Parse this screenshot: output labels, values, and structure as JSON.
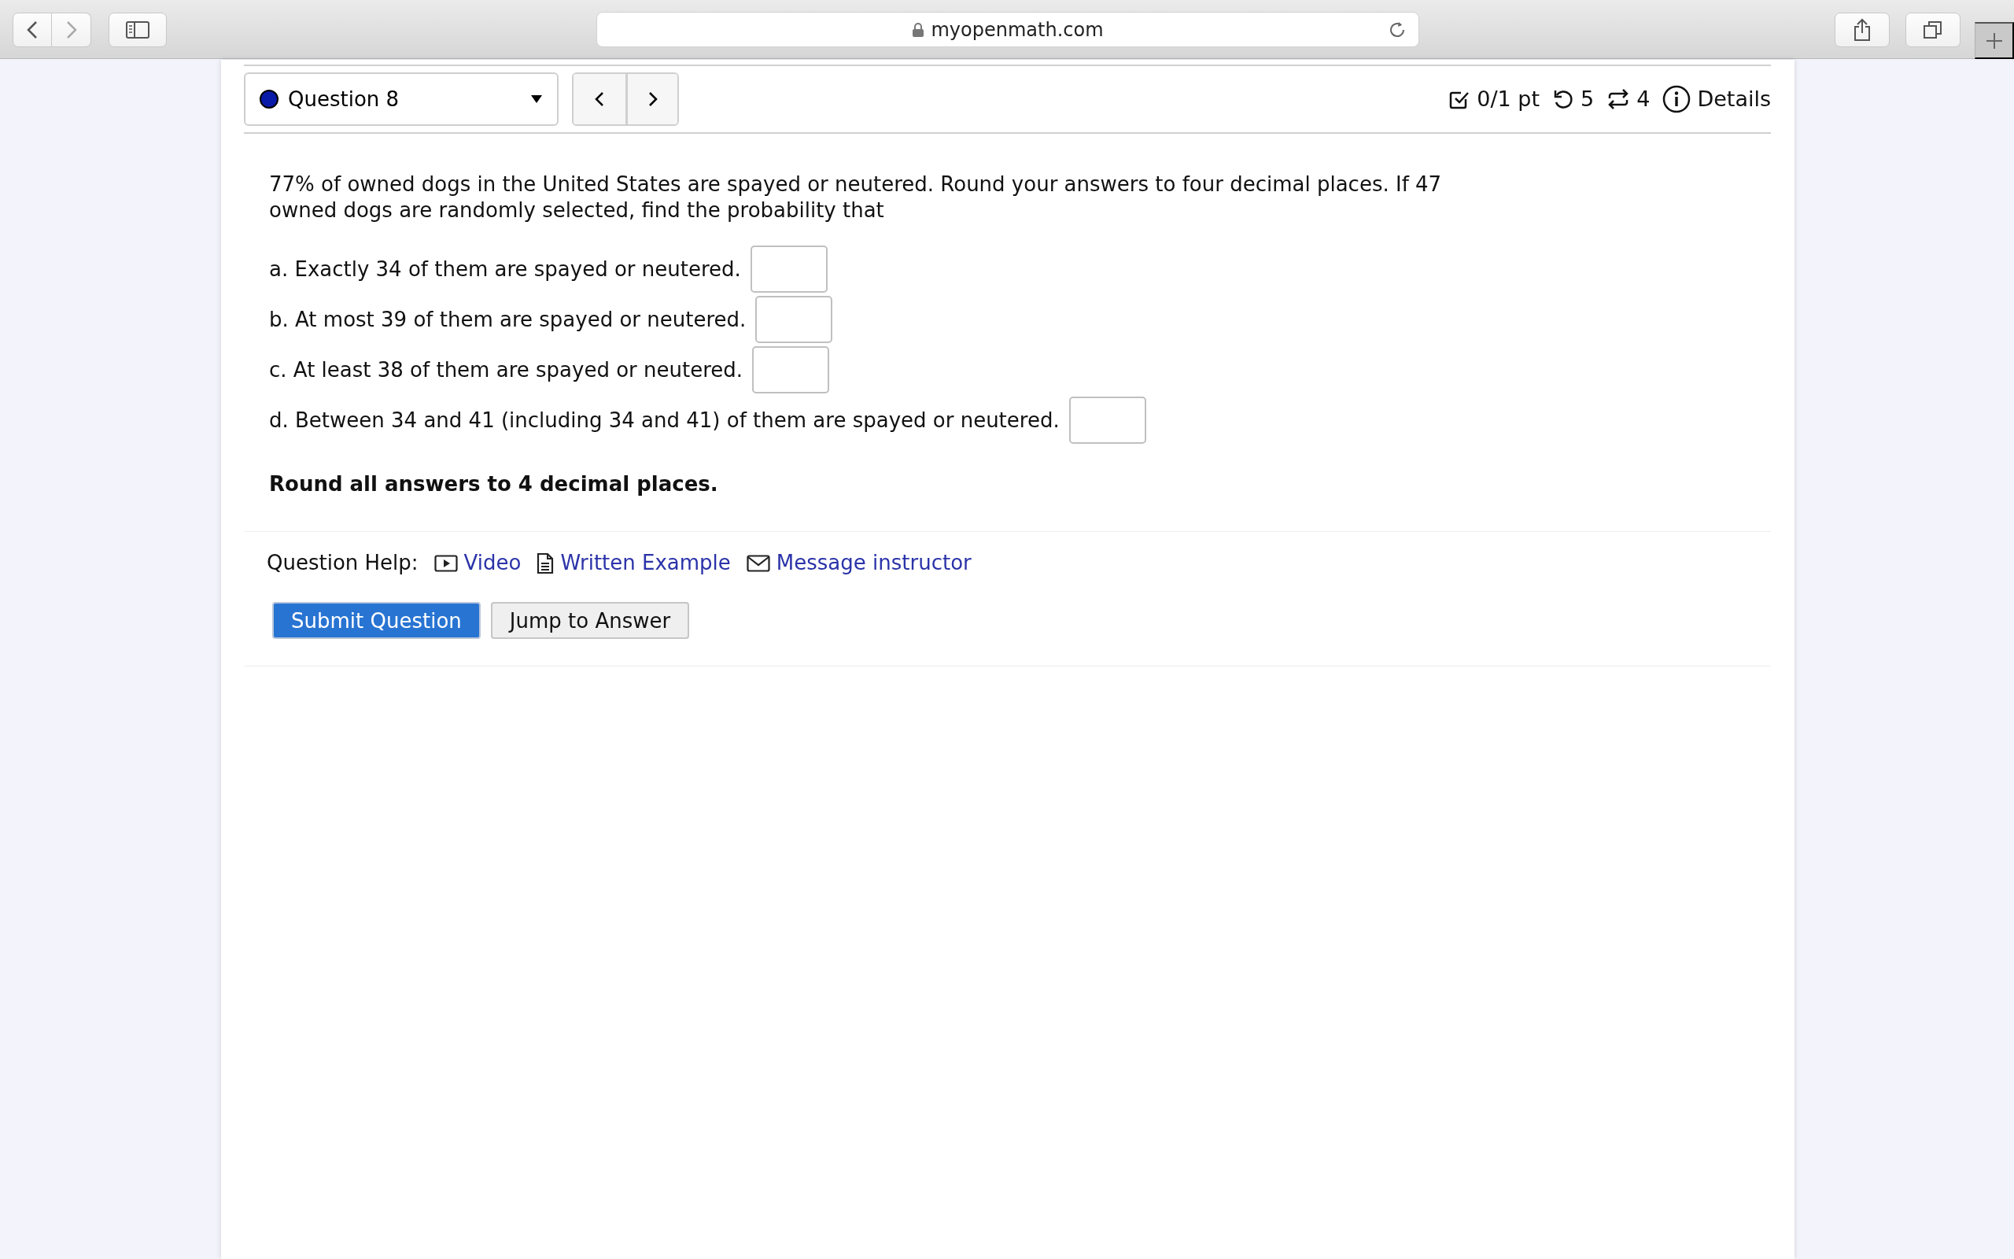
{
  "browser": {
    "url": "myopenmath.com"
  },
  "question_nav": {
    "label": "Question 8"
  },
  "score": {
    "points": "0/1 pt",
    "retries": "5",
    "versions": "4",
    "details": "Details"
  },
  "question": {
    "text": "77% of owned dogs in the United States are spayed or neutered. Round your answers to four decimal places. If 47 owned dogs are randomly selected, find the probability that",
    "parts": [
      {
        "label": "a. Exactly 34 of them are spayed or neutered."
      },
      {
        "label": "b. At most 39 of them are spayed or neutered."
      },
      {
        "label": "c. At least 38 of them are spayed or neutered."
      },
      {
        "label": "d. Between 34 and 41 (including 34 and 41) of them are spayed or neutered."
      }
    ],
    "note": "Round all answers to 4 decimal places."
  },
  "help": {
    "label": "Question Help:",
    "links": [
      {
        "kind": "video",
        "label": "Video"
      },
      {
        "kind": "document",
        "label": "Written Example"
      },
      {
        "kind": "mail",
        "label": "Message instructor"
      }
    ]
  },
  "buttons": [
    {
      "kind": "primary",
      "label": "Submit Question"
    },
    {
      "kind": "secondary",
      "label": "Jump to Answer"
    }
  ]
}
